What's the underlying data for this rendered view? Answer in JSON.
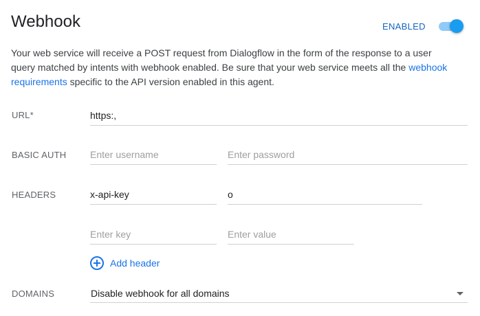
{
  "header": {
    "title": "Webhook",
    "enabled_label": "ENABLED",
    "enabled": true
  },
  "description": {
    "text_before": "Your web service will receive a POST request from Dialogflow in the form of the response to a user query matched by intents with webhook enabled. Be sure that your web service meets all the ",
    "link_text": "webhook requirements",
    "text_after": " specific to the API version enabled in this agent."
  },
  "url": {
    "label": "URL*",
    "value": "https:,"
  },
  "basic_auth": {
    "label": "BASIC AUTH",
    "username_placeholder": "Enter username",
    "password_placeholder": "Enter password"
  },
  "headers": {
    "label": "HEADERS",
    "rows": [
      {
        "key": "x-api-key",
        "value": "o"
      }
    ],
    "key_placeholder": "Enter key",
    "value_placeholder": "Enter value",
    "add_label": "Add header"
  },
  "domains": {
    "label": "DOMAINS",
    "selected": "Disable webhook for all domains"
  },
  "colors": {
    "accent": "#1a73e8",
    "toggle_on": "#1a9cf0",
    "toggle_track": "#90caf9"
  },
  "icons": {
    "add": "plus-circle-icon",
    "dropdown": "chevron-down-icon"
  }
}
